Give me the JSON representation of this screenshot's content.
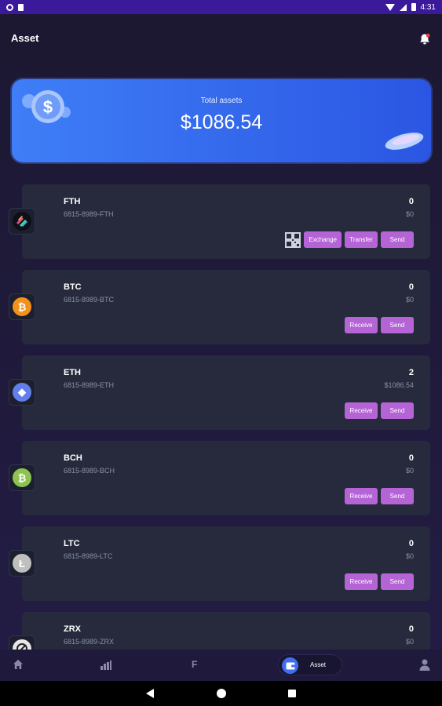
{
  "status_bar": {
    "time": "4:31"
  },
  "header": {
    "title": "Asset"
  },
  "total": {
    "label": "Total assets",
    "value": "$1086.54"
  },
  "assets": [
    {
      "symbol": "FTH",
      "address": "6815-8989-FTH",
      "balance": "0",
      "usd": "$0",
      "coin_color": "#0e0f18",
      "coin_glyph": "",
      "actions": [
        "Exchange",
        "Transfer",
        "Send"
      ],
      "qr": true
    },
    {
      "symbol": "BTC",
      "address": "6815-8989-BTC",
      "balance": "0",
      "usd": "$0",
      "coin_color": "#f3921a",
      "coin_glyph": "₿",
      "actions": [
        "Receive",
        "Send"
      ],
      "qr": false
    },
    {
      "symbol": "ETH",
      "address": "6815-8989-ETH",
      "balance": "2",
      "usd": "$1086.54",
      "coin_color": "#627eea",
      "coin_glyph": "◆",
      "actions": [
        "Receive",
        "Send"
      ],
      "qr": false
    },
    {
      "symbol": "BCH",
      "address": "6815-8989-BCH",
      "balance": "0",
      "usd": "$0",
      "coin_color": "#8dc351",
      "coin_glyph": "₿",
      "actions": [
        "Receive",
        "Send"
      ],
      "qr": false
    },
    {
      "symbol": "LTC",
      "address": "6815-8989-LTC",
      "balance": "0",
      "usd": "$0",
      "coin_color": "#bfbfbf",
      "coin_glyph": "Ł",
      "actions": [
        "Receive",
        "Send"
      ],
      "qr": false
    },
    {
      "symbol": "ZRX",
      "address": "6815-8989-ZRX",
      "balance": "0",
      "usd": "$0",
      "coin_color": "#e6e6e6",
      "coin_glyph": "",
      "actions": [],
      "qr": false
    }
  ],
  "bottom_nav": {
    "f_label": "F",
    "asset_label": "Asset"
  },
  "icons": {
    "bell": "bell-icon",
    "home": "home-icon",
    "chart": "bar-chart-icon",
    "wallet": "wallet-icon",
    "user": "user-icon",
    "qr": "qr-code-icon"
  },
  "colors": {
    "accent": "#b564d6",
    "card": "#262a3c",
    "total_card": "#3f7ef7"
  }
}
